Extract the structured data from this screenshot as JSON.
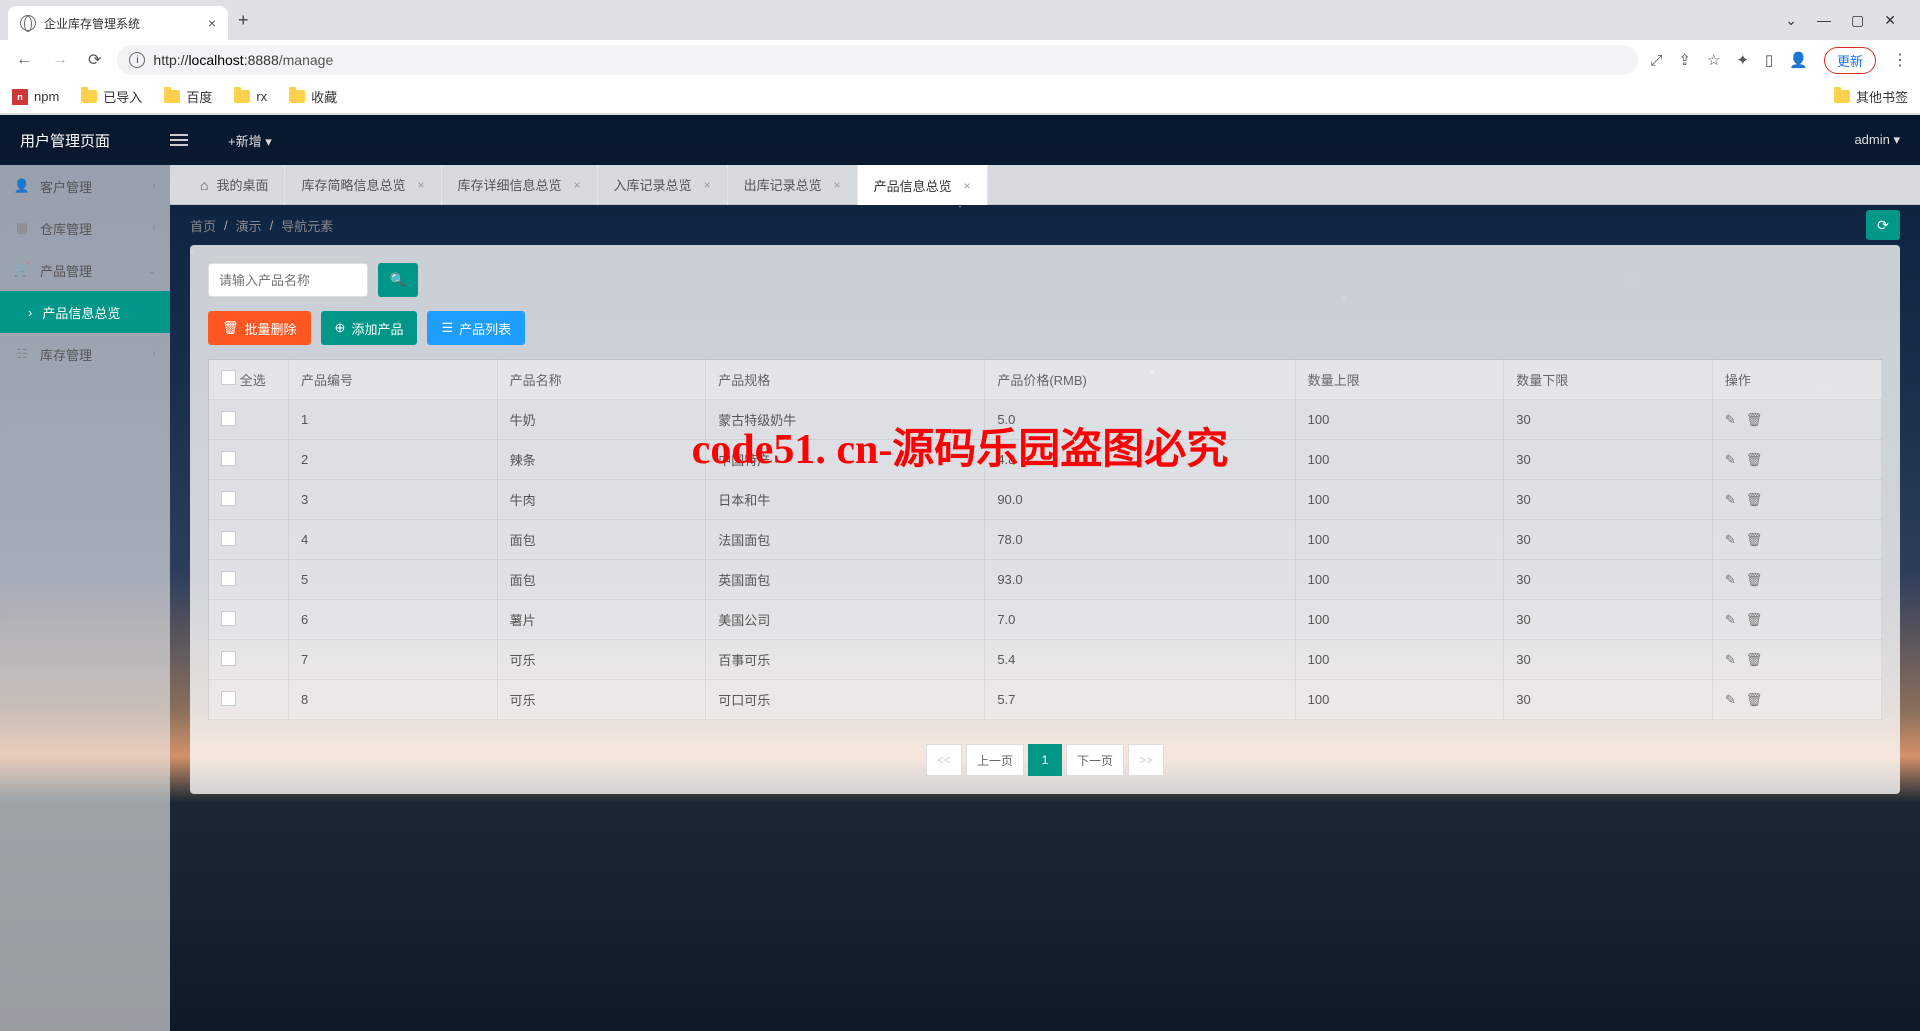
{
  "browser": {
    "tab_title": "企业库存管理系统",
    "url_prefix": "http://",
    "url_host": "localhost",
    "url_port": ":8888",
    "url_path": "/manage",
    "update_label": "更新",
    "bookmarks": [
      "npm",
      "已导入",
      "百度",
      "rx",
      "收藏"
    ],
    "other_bookmarks": "其他书签"
  },
  "header": {
    "brand": "用户管理页面",
    "add_label": "+新增 ▾",
    "user": "admin ▾"
  },
  "sidebar": {
    "items": [
      {
        "icon": "user",
        "label": "客户管理"
      },
      {
        "icon": "warehouse",
        "label": "仓库管理"
      },
      {
        "icon": "cart",
        "label": "产品管理"
      }
    ],
    "sub_label": "产品信息总览",
    "last": {
      "icon": "db",
      "label": "库存管理"
    }
  },
  "tabs": {
    "home": "我的桌面",
    "items": [
      "库存简略信息总览",
      "库存详细信息总览",
      "入库记录总览",
      "出库记录总览",
      "产品信息总览"
    ],
    "active_index": 4
  },
  "crumbs": {
    "a": "首页",
    "b": "演示",
    "c": "导航元素"
  },
  "search": {
    "placeholder": "请输入产品名称"
  },
  "buttons": {
    "batch_delete": "批量删除",
    "add_product": "添加产品",
    "product_list": "产品列表"
  },
  "table": {
    "headers": [
      "全选",
      "产品编号",
      "产品名称",
      "产品规格",
      "产品价格(RMB)",
      "数量上限",
      "数量下限",
      "操作"
    ],
    "rows": [
      {
        "id": "1",
        "name": "牛奶",
        "spec": "蒙古特级奶牛",
        "price": "5.0",
        "max": "100",
        "min": "30"
      },
      {
        "id": "2",
        "name": "辣条",
        "spec": "中国特产",
        "price": "4.8",
        "max": "100",
        "min": "30"
      },
      {
        "id": "3",
        "name": "牛肉",
        "spec": "日本和牛",
        "price": "90.0",
        "max": "100",
        "min": "30"
      },
      {
        "id": "4",
        "name": "面包",
        "spec": "法国面包",
        "price": "78.0",
        "max": "100",
        "min": "30"
      },
      {
        "id": "5",
        "name": "面包",
        "spec": "英国面包",
        "price": "93.0",
        "max": "100",
        "min": "30"
      },
      {
        "id": "6",
        "name": "薯片",
        "spec": "美国公司",
        "price": "7.0",
        "max": "100",
        "min": "30"
      },
      {
        "id": "7",
        "name": "可乐",
        "spec": "百事可乐",
        "price": "5.4",
        "max": "100",
        "min": "30"
      },
      {
        "id": "8",
        "name": "可乐",
        "spec": "可口可乐",
        "price": "5.7",
        "max": "100",
        "min": "30"
      }
    ]
  },
  "pager": {
    "first": "<<",
    "prev": "上一页",
    "current": "1",
    "next": "下一页",
    "last": ">>"
  },
  "watermark": "code51. cn-源码乐园盗图必究"
}
